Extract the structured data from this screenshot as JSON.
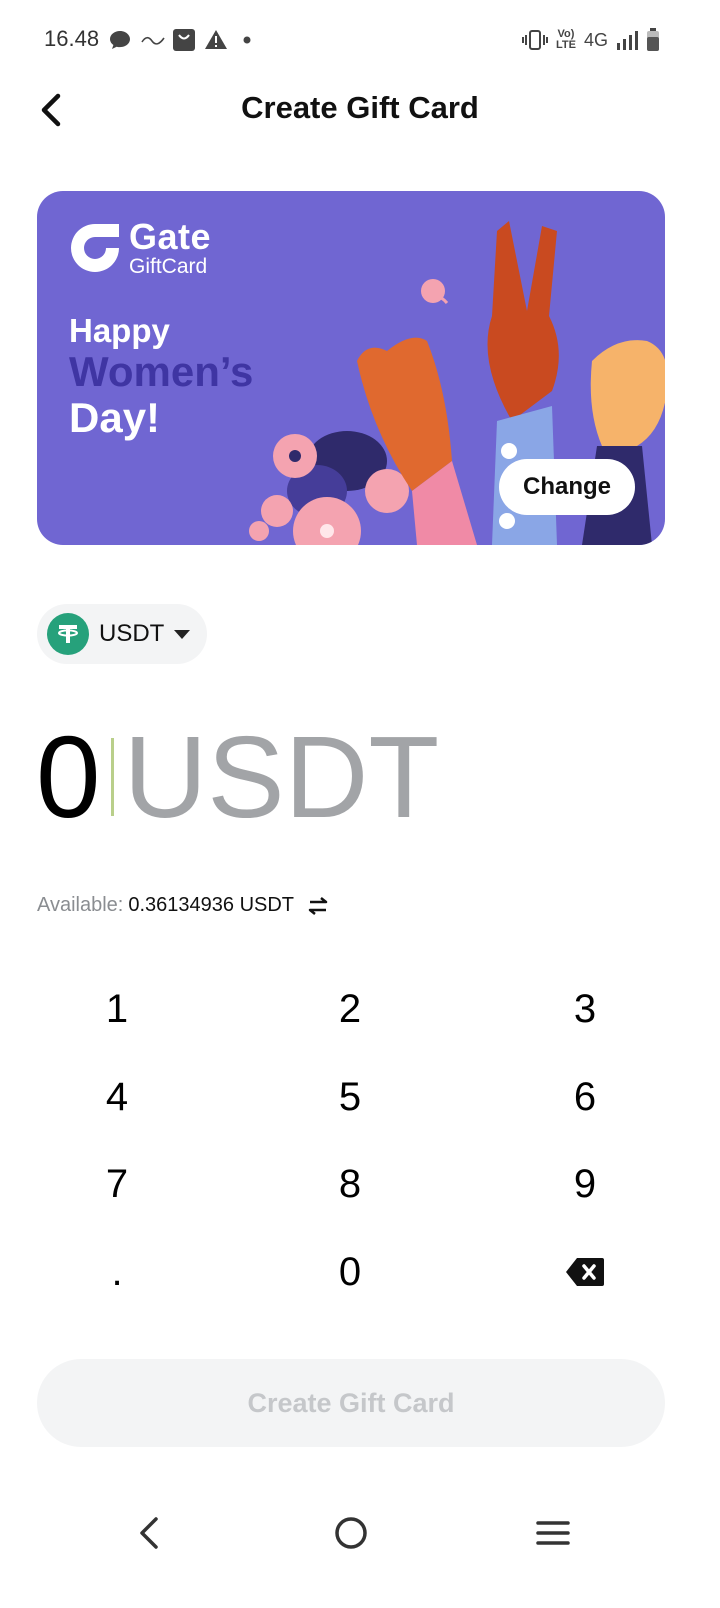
{
  "status_bar": {
    "time": "16.48",
    "network": "4G",
    "volte": "Vo) LTE",
    "icons": [
      "message-icon",
      "app-icon",
      "shopping-bag-icon",
      "warning-icon",
      "dot-icon",
      "vibrate-icon",
      "signal-icon",
      "battery-icon"
    ]
  },
  "header": {
    "title": "Create Gift Card"
  },
  "gift_card": {
    "brand_name": "Gate",
    "brand_sub": "GiftCard",
    "greeting_line1": "Happy",
    "greeting_line2": "Women’s",
    "greeting_line3": "Day!",
    "change_label": "Change",
    "background_color": "#7066d2"
  },
  "currency": {
    "selected": "USDT",
    "icon": "tether-icon"
  },
  "amount": {
    "value": "0",
    "unit": "USDT"
  },
  "available": {
    "label": "Available:",
    "value": "0.36134936 USDT"
  },
  "keypad": {
    "keys": [
      "1",
      "2",
      "3",
      "4",
      "5",
      "6",
      "7",
      "8",
      "9",
      ".",
      "0"
    ]
  },
  "create_button": {
    "label": "Create Gift Card",
    "enabled": false
  },
  "colors": {
    "card_purple": "#7066d2",
    "tether_green": "#26a17b",
    "muted_text": "#a2a4a7",
    "disabled_button": "#f3f4f5"
  }
}
